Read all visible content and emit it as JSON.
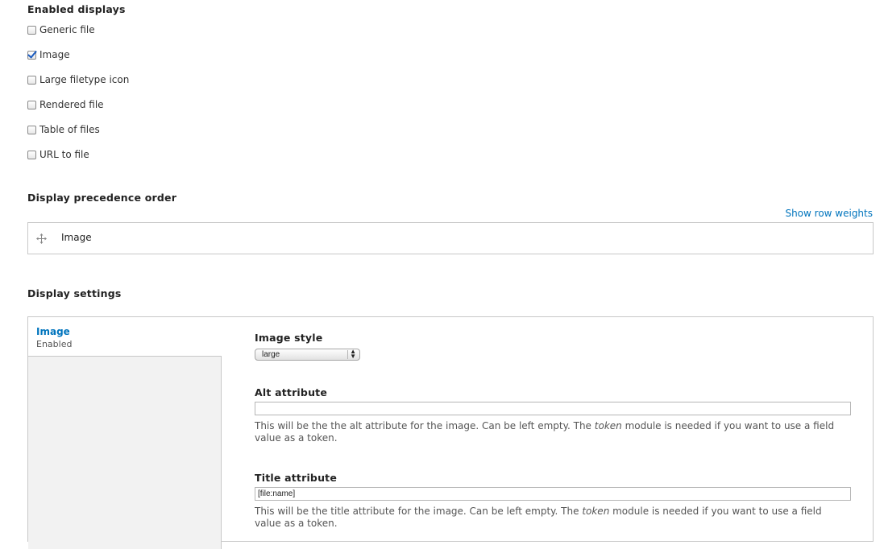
{
  "enabled_displays": {
    "heading": "Enabled displays",
    "items": [
      {
        "label": "Generic file",
        "checked": false
      },
      {
        "label": "Image",
        "checked": true
      },
      {
        "label": "Large filetype icon",
        "checked": false
      },
      {
        "label": "Rendered file",
        "checked": false
      },
      {
        "label": "Table of files",
        "checked": false
      },
      {
        "label": "URL to file",
        "checked": false
      }
    ]
  },
  "precedence": {
    "heading": "Display precedence order",
    "show_weights_link": "Show row weights",
    "rows": [
      {
        "label": "Image"
      }
    ]
  },
  "settings": {
    "heading": "Display settings",
    "vertical_tab": {
      "title": "Image",
      "summary": "Enabled"
    },
    "image_style": {
      "label": "Image style",
      "value": "large"
    },
    "alt": {
      "label": "Alt attribute",
      "value": "",
      "desc_before": "This will be the the alt attribute for the image. Can be left empty. The ",
      "desc_em": "token",
      "desc_after": " module is needed if you want to use a field value as a token."
    },
    "title": {
      "label": "Title attribute",
      "value": "[file:name]",
      "desc_before": "This will be the title attribute for the image. Can be left empty. The ",
      "desc_em": "token",
      "desc_after": " module is needed if you want to use a field value as a token."
    }
  },
  "colors": {
    "link": "#0074bd",
    "border": "#c8c8c8",
    "tab_bg": "#f2f2f2"
  }
}
